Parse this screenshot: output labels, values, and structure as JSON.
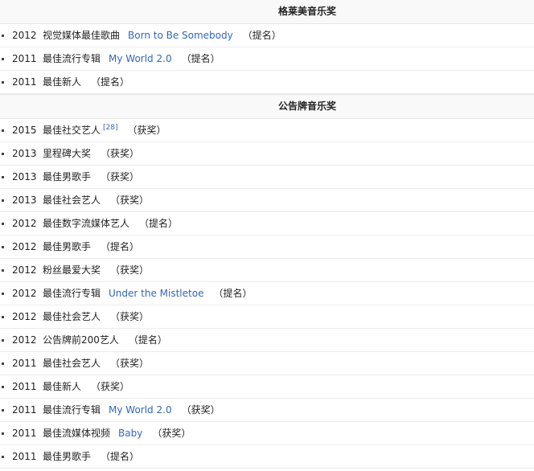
{
  "sections": [
    {
      "title": "格莱美音乐奖",
      "rows": [
        {
          "year": "2012",
          "award": "视觉媒体最佳歌曲",
          "work": "Born to Be Somebody",
          "ref": "",
          "result": "（提名）"
        },
        {
          "year": "2011",
          "award": "最佳流行专辑",
          "work": "My World 2.0",
          "ref": "",
          "result": "（提名）"
        },
        {
          "year": "2011",
          "award": "最佳新人",
          "work": "",
          "ref": "",
          "result": "（提名）"
        }
      ]
    },
    {
      "title": "公告牌音乐奖",
      "rows": [
        {
          "year": "2015",
          "award": "最佳社交艺人",
          "work": "",
          "ref": "[28]",
          "result": "（获奖）"
        },
        {
          "year": "2013",
          "award": "里程碑大奖",
          "work": "",
          "ref": "",
          "result": "（获奖）"
        },
        {
          "year": "2013",
          "award": "最佳男歌手",
          "work": "",
          "ref": "",
          "result": "（获奖）"
        },
        {
          "year": "2013",
          "award": "最佳社会艺人",
          "work": "",
          "ref": "",
          "result": "（获奖）"
        },
        {
          "year": "2012",
          "award": "最佳数字流媒体艺人",
          "work": "",
          "ref": "",
          "result": "（提名）"
        },
        {
          "year": "2012",
          "award": "最佳男歌手",
          "work": "",
          "ref": "",
          "result": "（提名）"
        },
        {
          "year": "2012",
          "award": "粉丝最爱大奖",
          "work": "",
          "ref": "",
          "result": "（获奖）"
        },
        {
          "year": "2012",
          "award": "最佳流行专辑",
          "work": "Under the Mistletoe",
          "ref": "",
          "result": "（提名）"
        },
        {
          "year": "2012",
          "award": "最佳社会艺人",
          "work": "",
          "ref": "",
          "result": "（获奖）"
        },
        {
          "year": "2012",
          "award": "公告牌前200艺人",
          "work": "",
          "ref": "",
          "result": "（提名）"
        },
        {
          "year": "2011",
          "award": "最佳社会艺人",
          "work": "",
          "ref": "",
          "result": "（获奖）"
        },
        {
          "year": "2011",
          "award": "最佳新人",
          "work": "",
          "ref": "",
          "result": "（获奖）"
        },
        {
          "year": "2011",
          "award": "最佳流行专辑",
          "work": "My World 2.0",
          "ref": "",
          "result": "（获奖）"
        },
        {
          "year": "2011",
          "award": "最佳流媒体视频",
          "work": "Baby",
          "ref": "",
          "result": "（获奖）"
        },
        {
          "year": "2011",
          "award": "最佳男歌手",
          "work": "",
          "ref": "",
          "result": "（提名）"
        }
      ]
    }
  ]
}
